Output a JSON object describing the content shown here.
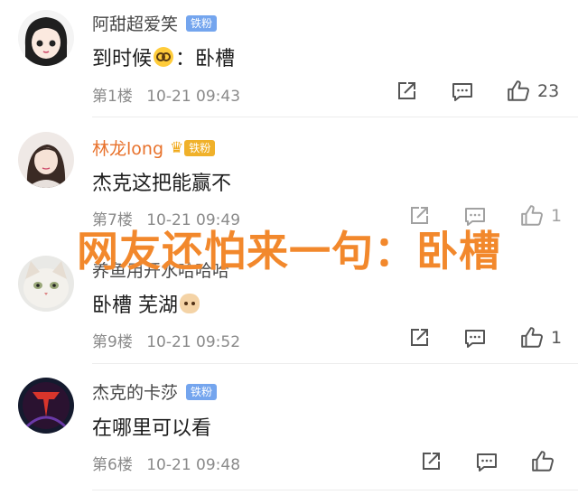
{
  "comments": [
    {
      "username": "阿甜超爱笑",
      "badge": "铁粉",
      "text_before": "到时候",
      "text_emoji": "nerd-emoji",
      "text_after": "：卧槽",
      "floor": "第1楼",
      "timestamp": "10-21 09:43",
      "likes": "23"
    },
    {
      "username": "林龙long",
      "badge": "铁粉",
      "text": "杰克这把能赢不",
      "floor": "第7楼",
      "timestamp": "10-21 09:49",
      "likes": "1"
    },
    {
      "username": "养鱼用开水哈哈哈",
      "text_before": "卧槽 芜湖",
      "text_emoji": "cat-emoji",
      "floor": "第9楼",
      "timestamp": "10-21 09:52",
      "likes": "1"
    },
    {
      "username": "杰克的卡莎",
      "badge": "铁粉",
      "text": "在哪里可以看",
      "floor": "第6楼",
      "timestamp": "10-21 09:48",
      "likes": ""
    }
  ],
  "overlay_caption": "网友还怕来一句：卧槽",
  "colors": {
    "badge_blue": "#74a5ee",
    "badge_gold": "#f0b12a",
    "vip_name": "#e8722c",
    "overlay": "#f2882c"
  }
}
